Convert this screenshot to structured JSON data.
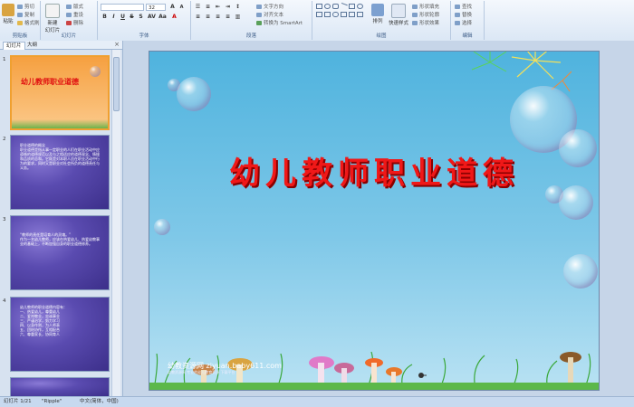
{
  "ribbon": {
    "clipboard": {
      "label": "剪贴板",
      "paste": "粘贴",
      "cut": "剪切",
      "copy": "复制",
      "format_painter": "格式刷"
    },
    "slides": {
      "label": "幻灯片",
      "new_slide": "新建\n幻灯片",
      "layout": "版式",
      "reset": "重设",
      "delete": "删除"
    },
    "font": {
      "label": "字体",
      "font_size": "32"
    },
    "paragraph": {
      "label": "段落",
      "text_direction": "文字方向",
      "align_text": "对齐文本",
      "smartart": "转换为 SmartArt"
    },
    "drawing": {
      "label": "绘图",
      "arrange": "排列",
      "quick_styles": "快速样式",
      "shape_fill": "形状填充",
      "shape_outline": "形状轮廓",
      "shape_effects": "形状效果"
    },
    "editing": {
      "label": "编辑",
      "find": "查找",
      "replace": "替换",
      "select": "选择"
    }
  },
  "panel": {
    "tab_slides": "幻灯片",
    "tab_outline": "大纲",
    "close": "×"
  },
  "thumbnails": [
    {
      "num": "1",
      "title": "幼儿教师职业道德"
    },
    {
      "num": "2",
      "text": "职业道德的概念\n职业道德是指从事一定职业的人们在职业活动中应遵循的道德规范以及与之相适应的道德观念、情操和品质的总和。它既是对本职人员在职业活动中行为的要求，同时又是职业对社会所负的道德责任与义务。"
    },
    {
      "num": "3",
      "text": "“教师的责任是培育人的灵魂。”\n作为一名幼儿教师，应该在热爱幼儿、热爱幼教事业的基础上，不断加强自身的职业道德修养。"
    },
    {
      "num": "4",
      "text": "幼儿教师的职业道德内容有：\n一、热爱幼儿，尊重幼儿\n二、爱岗敬业，忠诚事业\n三、严谨治学，努力学习\n四、以身作则，为人师表\n五、团结协作，互相配合\n六、尊重家长，协同育人"
    }
  ],
  "slide": {
    "title": "幼儿教师职业道德",
    "watermark": "幼教资源网 ziyuan.baby611.com",
    "watermark_sub": "幼教资源网 专业的幼儿教育资源 下载平台"
  },
  "status": {
    "slide_info": "幻灯片 1/21",
    "theme": "\"Ripple\"",
    "language": "中文(简体，中国)"
  },
  "colors": {
    "title_red": "#f01818",
    "selected_border": "#f0a030",
    "sky": "#4fb3de"
  }
}
